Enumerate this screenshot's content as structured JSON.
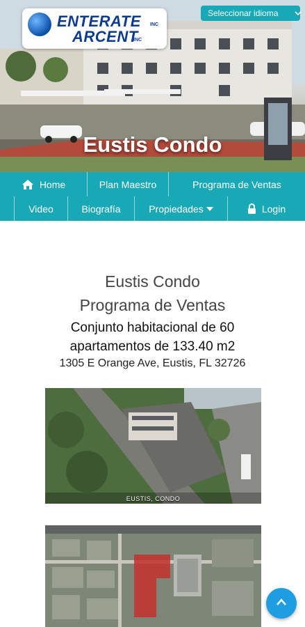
{
  "header": {
    "logo_line1": "ENTERATE",
    "logo_line2": "ARCENT",
    "logo_inc": "INC",
    "language_button": "Seleccionar idioma",
    "hero_title": "Eustis Condo"
  },
  "nav": {
    "row1": [
      {
        "label": "Home",
        "icon": "home-icon"
      },
      {
        "label": "Plan Maestro"
      },
      {
        "label": "Programa de Ventas"
      }
    ],
    "row2": [
      {
        "label": "Video"
      },
      {
        "label": "Biografía"
      },
      {
        "label": "Propiedades",
        "icon": "caret-down-icon"
      },
      {
        "label": "Login",
        "icon": "lock-icon"
      }
    ]
  },
  "main": {
    "title": "Eustis Condo",
    "subtitle": "Programa de Ventas",
    "description_line1": "Conjunto habitacional de 60",
    "description_line2": "apartamentos de 133.40 m2",
    "address": "1305 E Orange Ave, Eustis, FL 32726",
    "image1_caption": "EUSTIS, CONDO"
  },
  "colors": {
    "accent": "#19a9b6",
    "scroll_button": "#1e9ee0",
    "text_dark": "#444444"
  }
}
